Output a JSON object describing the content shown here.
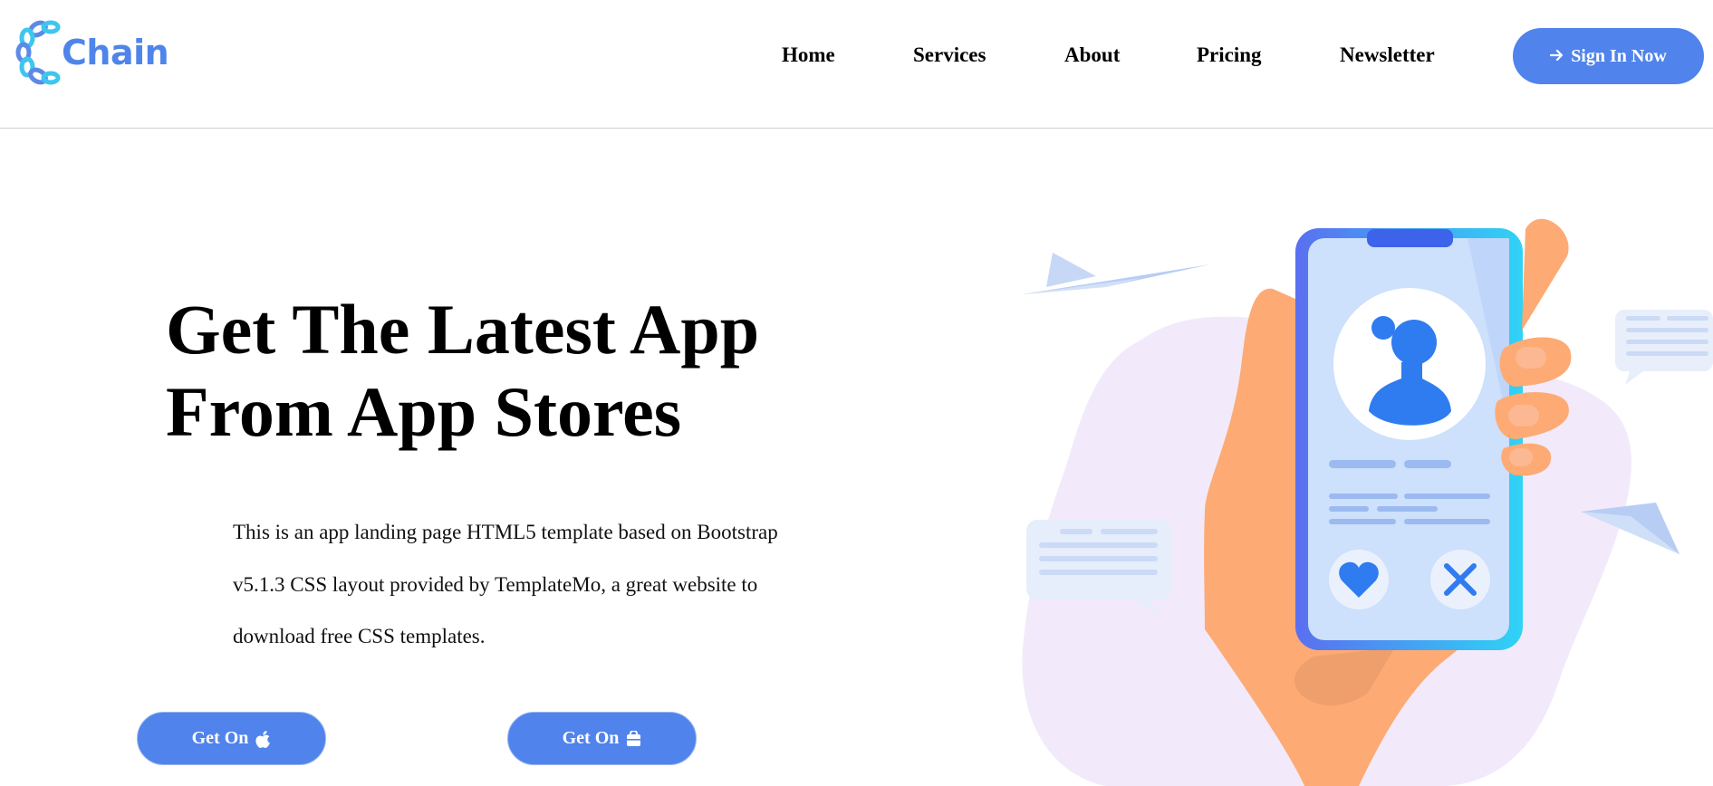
{
  "brand": {
    "name": "Chain",
    "color": "#4f85ea"
  },
  "nav": {
    "items": [
      "Home",
      "Services",
      "About",
      "Pricing",
      "Newsletter"
    ],
    "signin_label": "Sign In Now"
  },
  "hero": {
    "title_line1": "Get The Latest App",
    "title_line2": "From App Stores",
    "description": "This is an app landing page HTML5 template based on Bootstrap v5.1.3 CSS layout provided by TemplateMo, a great website to download free CSS templates.",
    "buttons": [
      {
        "label": "Get On",
        "icon": "apple-icon"
      },
      {
        "label": "Get On",
        "icon": "store-bag-icon"
      }
    ]
  },
  "colors": {
    "accent": "#5083eb",
    "blob": "#f2eafa",
    "hand": "#fdaa74",
    "phone_gradient_start": "#5a6ff0",
    "phone_gradient_end": "#2fd3f5",
    "avatar": "#2f7bf0"
  }
}
